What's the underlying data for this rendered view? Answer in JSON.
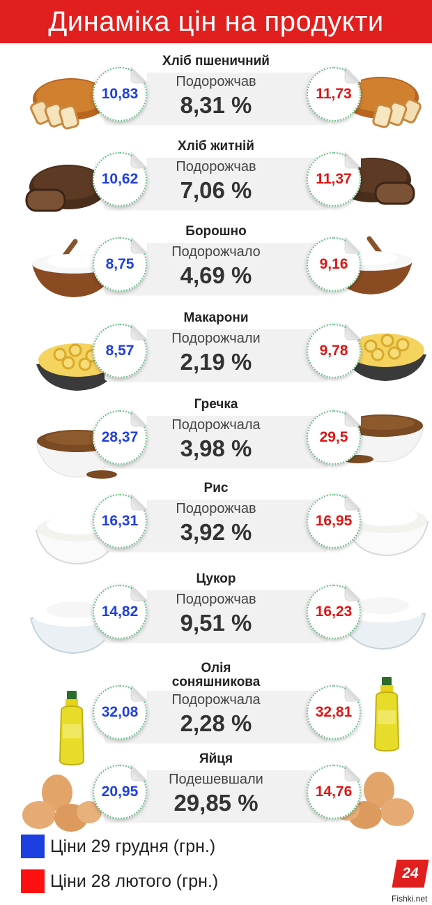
{
  "header": {
    "title": "Динаміка цін на продукти"
  },
  "colors": {
    "old_price": "#1e3fe0",
    "new_price": "#e11414",
    "header_bg": "#e11f1f"
  },
  "products": [
    {
      "name": "Хліб пшеничний",
      "status": "Подорожчав",
      "percent": "8,31 %",
      "old_price": "10,83",
      "new_price": "11,73",
      "icon": "wheat-bread-icon"
    },
    {
      "name": "Хліб житній",
      "status": "Подорожчав",
      "percent": "7,06 %",
      "old_price": "10,62",
      "new_price": "11,37",
      "icon": "rye-bread-icon"
    },
    {
      "name": "Борошно",
      "status": "Подорожчало",
      "percent": "4,69 %",
      "old_price": "8,75",
      "new_price": "9,16",
      "icon": "flour-bowl-icon"
    },
    {
      "name": "Макарони",
      "status": "Подорожчали",
      "percent": "2,19 %",
      "old_price": "8,57",
      "new_price": "9,78",
      "icon": "macaroni-bowl-icon"
    },
    {
      "name": "Гречка",
      "status": "Подорожчала",
      "percent": "3,98 %",
      "old_price": "28,37",
      "new_price": "29,5",
      "icon": "buckwheat-bowl-icon"
    },
    {
      "name": "Рис",
      "status": "Подорожчав",
      "percent": "3,92 %",
      "old_price": "16,31",
      "new_price": "16,95",
      "icon": "rice-bowl-icon"
    },
    {
      "name": "Цукор",
      "status": "Подорожчав",
      "percent": "9,51 %",
      "old_price": "14,82",
      "new_price": "16,23",
      "icon": "sugar-bowl-icon"
    },
    {
      "name": "Олія\nсоняшникова",
      "status": "Подорожчала",
      "percent": "2,28 %",
      "old_price": "32,08",
      "new_price": "32,81",
      "icon": "oil-bottle-icon"
    },
    {
      "name": "Яйця",
      "status": "Подешевшали",
      "percent": "29,85 %",
      "old_price": "20,95",
      "new_price": "14,76",
      "icon": "eggs-icon"
    }
  ],
  "legend": {
    "old_label": "Ціни 29 грудня (грн.)",
    "new_label": "Ціни 28 лютого (грн.)"
  },
  "branding": {
    "logo_text": "24",
    "credit": "Fishki.net"
  }
}
